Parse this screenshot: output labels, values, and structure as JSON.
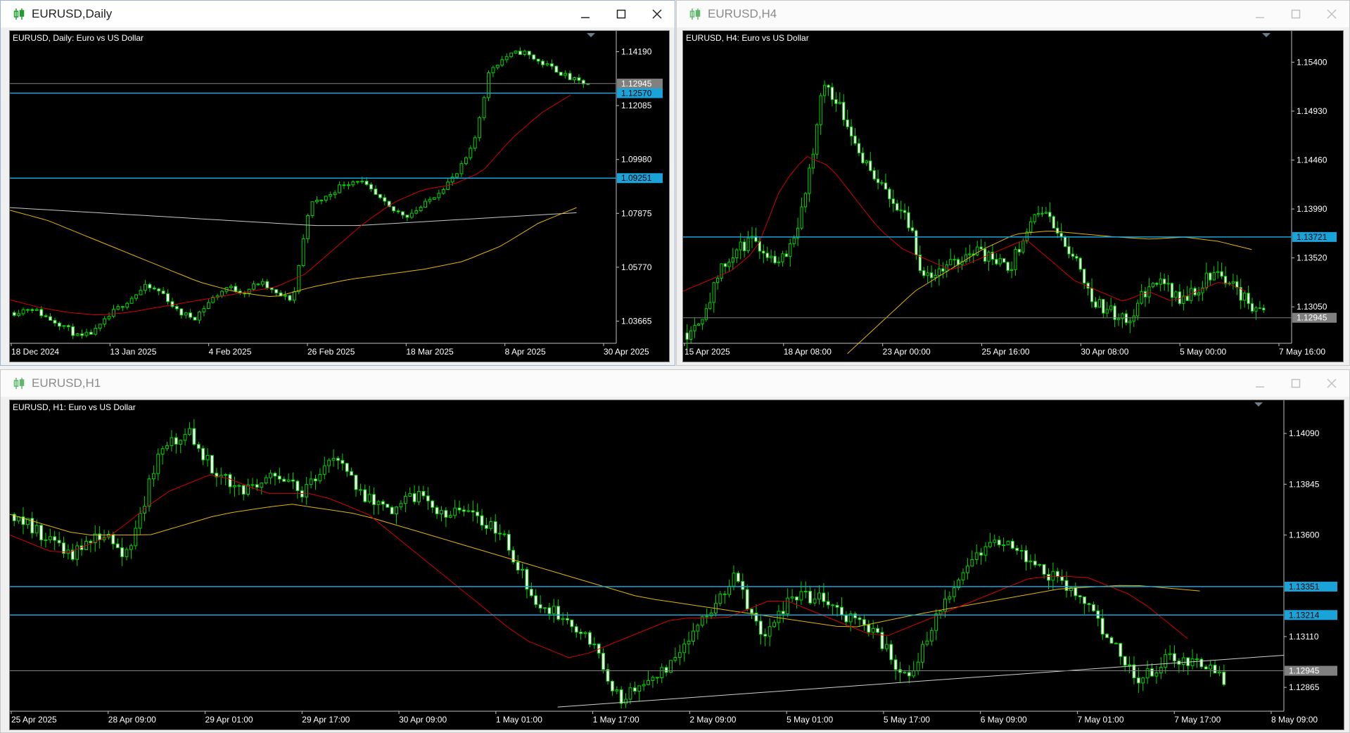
{
  "colors": {
    "bg": "#000000",
    "bull": "#00d400",
    "grid": "#ffffff",
    "hline": "#1aa3d9",
    "hline_label_bg": "#1aa3d9",
    "price_label_bg": "#808080",
    "ma_red": "#d40000",
    "ma_yellow": "#e6b400",
    "ma_white": "#c8c8c8",
    "trend": "#d0d0d0"
  },
  "windows": [
    {
      "id": "daily",
      "title": "EURUSD,Daily",
      "active": true,
      "chart_label": "EURUSD, Daily:  Euro vs US Dollar",
      "price_ticks": [
        "1.14190",
        "1.12085",
        "1.09980",
        "1.07875",
        "1.05770",
        "1.03665"
      ],
      "date_ticks": [
        "18 Dec 2024",
        "13 Jan 2025",
        "4 Feb 2025",
        "26 Feb 2025",
        "18 Mar 2025",
        "8 Apr 2025",
        "30 Apr 2025"
      ],
      "hlines": [
        "1.12570",
        "1.09251"
      ],
      "price_label": "1.12945"
    },
    {
      "id": "h4",
      "title": "EURUSD,H4",
      "active": false,
      "chart_label": "EURUSD, H4:  Euro vs US Dollar",
      "price_ticks": [
        "1.15400",
        "1.14930",
        "1.14460",
        "1.13990",
        "1.13520",
        "1.13050"
      ],
      "date_ticks": [
        "15 Apr 2025",
        "18 Apr 08:00",
        "23 Apr 00:00",
        "25 Apr 16:00",
        "30 Apr 08:00",
        "5 May 00:00",
        "7 May 16:00"
      ],
      "hlines": [
        "1.13721"
      ],
      "price_label": "1.12945"
    },
    {
      "id": "h1",
      "title": "EURUSD,H1",
      "active": false,
      "chart_label": "EURUSD, H1:  Euro vs US Dollar",
      "price_ticks": [
        "1.14090",
        "1.13845",
        "1.13600",
        "1.13110",
        "1.12865"
      ],
      "date_ticks": [
        "25 Apr 2025",
        "28 Apr 09:00",
        "29 Apr 01:00",
        "29 Apr 17:00",
        "30 Apr 09:00",
        "1 May 01:00",
        "1 May 17:00",
        "2 May 09:00",
        "5 May 01:00",
        "5 May 17:00",
        "6 May 09:00",
        "7 May 01:00",
        "7 May 17:00",
        "8 May 09:00"
      ],
      "hlines": [
        "1.13351",
        "1.13214"
      ],
      "price_label": "1.12945"
    }
  ],
  "chart_data": [
    {
      "type": "candlestick",
      "symbol": "EURUSD",
      "timeframe": "Daily",
      "approx_range": [
        1.028,
        1.15
      ],
      "series_shape_close": [
        1.04,
        1.042,
        1.038,
        1.035,
        1.03,
        1.033,
        1.04,
        1.045,
        1.05,
        1.048,
        1.04,
        1.038,
        1.045,
        1.05,
        1.048,
        1.052,
        1.047,
        1.045,
        1.082,
        1.085,
        1.09,
        1.092,
        1.086,
        1.08,
        1.078,
        1.082,
        1.088,
        1.094,
        1.105,
        1.135,
        1.14,
        1.142,
        1.138,
        1.135,
        1.131,
        1.129
      ],
      "ma_red_shape": [
        1.045,
        1.042,
        1.04,
        1.039,
        1.04,
        1.042,
        1.044,
        1.046,
        1.048,
        1.05,
        1.055,
        1.065,
        1.075,
        1.083,
        1.088,
        1.09,
        1.095,
        1.108,
        1.118,
        1.125
      ],
      "ma_yellow_shape": [
        1.08,
        1.076,
        1.07,
        1.064,
        1.058,
        1.052,
        1.048,
        1.046,
        1.05,
        1.053,
        1.055,
        1.057,
        1.06,
        1.066,
        1.075,
        1.081
      ],
      "ma_white_shape": [
        1.081,
        1.08,
        1.079,
        1.078,
        1.077,
        1.076,
        1.075,
        1.074,
        1.074,
        1.075,
        1.076,
        1.077,
        1.078,
        1.079
      ]
    },
    {
      "type": "candlestick",
      "symbol": "EURUSD",
      "timeframe": "H4",
      "approx_range": [
        1.127,
        1.157
      ],
      "series_shape_close": [
        1.128,
        1.13,
        1.134,
        1.136,
        1.137,
        1.135,
        1.136,
        1.141,
        1.152,
        1.15,
        1.146,
        1.143,
        1.141,
        1.139,
        1.133,
        1.134,
        1.135,
        1.136,
        1.135,
        1.134,
        1.138,
        1.14,
        1.137,
        1.135,
        1.131,
        1.13,
        1.129,
        1.132,
        1.133,
        1.131,
        1.132,
        1.134,
        1.133,
        1.131,
        1.13
      ],
      "ma_red_shape": [
        1.132,
        1.133,
        1.134,
        1.136,
        1.142,
        1.145,
        1.144,
        1.141,
        1.138,
        1.136,
        1.135,
        1.134,
        1.135,
        1.136,
        1.137,
        1.135,
        1.133,
        1.132,
        1.131,
        1.132,
        1.131,
        1.132,
        1.133,
        1.132
      ],
      "ma_yellow_shape": [
        1.126,
        1.129,
        1.132,
        1.134,
        1.136,
        1.1375,
        1.1378,
        1.1375,
        1.1372,
        1.137,
        1.1372,
        1.1368,
        1.136
      ]
    },
    {
      "type": "candlestick",
      "symbol": "EURUSD",
      "timeframe": "H1",
      "approx_range": [
        1.1275,
        1.1425
      ],
      "series_shape_close": [
        1.137,
        1.136,
        1.135,
        1.136,
        1.135,
        1.14,
        1.141,
        1.139,
        1.138,
        1.139,
        1.138,
        1.14,
        1.138,
        1.137,
        1.138,
        1.137,
        1.137,
        1.136,
        1.133,
        1.132,
        1.131,
        1.128,
        1.129,
        1.13,
        1.132,
        1.134,
        1.131,
        1.133,
        1.133,
        1.132,
        1.131,
        1.129,
        1.132,
        1.134,
        1.136,
        1.135,
        1.134,
        1.133,
        1.131,
        1.129,
        1.13,
        1.13,
        1.129
      ],
      "ma_red_shape": [
        1.136,
        1.135,
        1.136,
        1.138,
        1.139,
        1.138,
        1.138,
        1.137,
        1.135,
        1.133,
        1.131,
        1.13,
        1.131,
        1.132,
        1.132,
        1.133,
        1.132,
        1.131,
        1.132,
        1.133,
        1.134,
        1.134,
        1.133,
        1.131
      ],
      "ma_yellow_shape": [
        1.137,
        1.136,
        1.136,
        1.137,
        1.1375,
        1.137,
        1.136,
        1.135,
        1.134,
        1.133,
        1.1325,
        1.132,
        1.1315,
        1.1322,
        1.1328,
        1.1334,
        1.1336,
        1.1333
      ]
    }
  ]
}
